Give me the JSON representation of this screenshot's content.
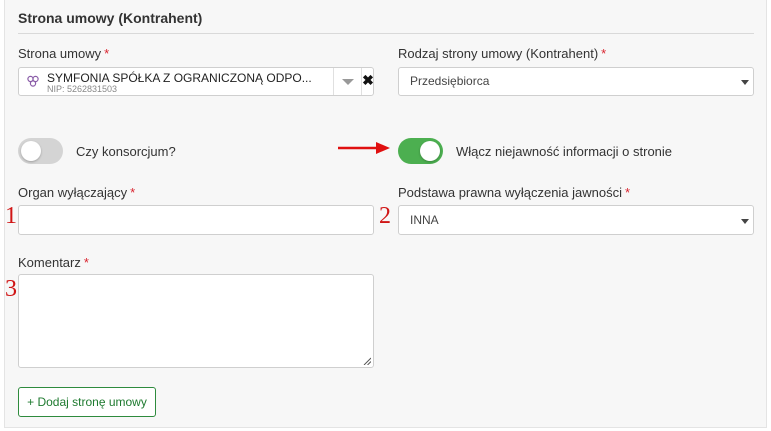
{
  "section": {
    "title": "Strona umowy (Kontrahent)"
  },
  "party": {
    "label": "Strona umowy",
    "required_mark": "*",
    "name": "SYMFONIA SPÓŁKA Z OGRANICZONĄ ODPO...",
    "nip": "NIP: 5262831503",
    "clear_glyph": "✖"
  },
  "party_type": {
    "label": "Rodzaj strony umowy (Kontrahent)",
    "required_mark": "*",
    "value": "Przedsiębiorca"
  },
  "consortium": {
    "label": "Czy konsorcjum?",
    "checked": false
  },
  "confidential": {
    "label": "Włącz niejawność informacji o stronie",
    "checked": true
  },
  "excluding_body": {
    "label": "Organ wyłączający",
    "required_mark": "*",
    "value": ""
  },
  "legal_basis": {
    "label": "Podstawa prawna wyłączenia jawności",
    "required_mark": "*",
    "value": "INNA"
  },
  "comment": {
    "label": "Komentarz",
    "required_mark": "*",
    "value": ""
  },
  "add_button": {
    "label": "+ Dodaj stronę umowy"
  },
  "annotations": {
    "n1": "1",
    "n2": "2",
    "n3": "3"
  },
  "colors": {
    "accent_green": "#4caf50",
    "required_red": "#d9232e",
    "annotation_red": "#d01515"
  }
}
